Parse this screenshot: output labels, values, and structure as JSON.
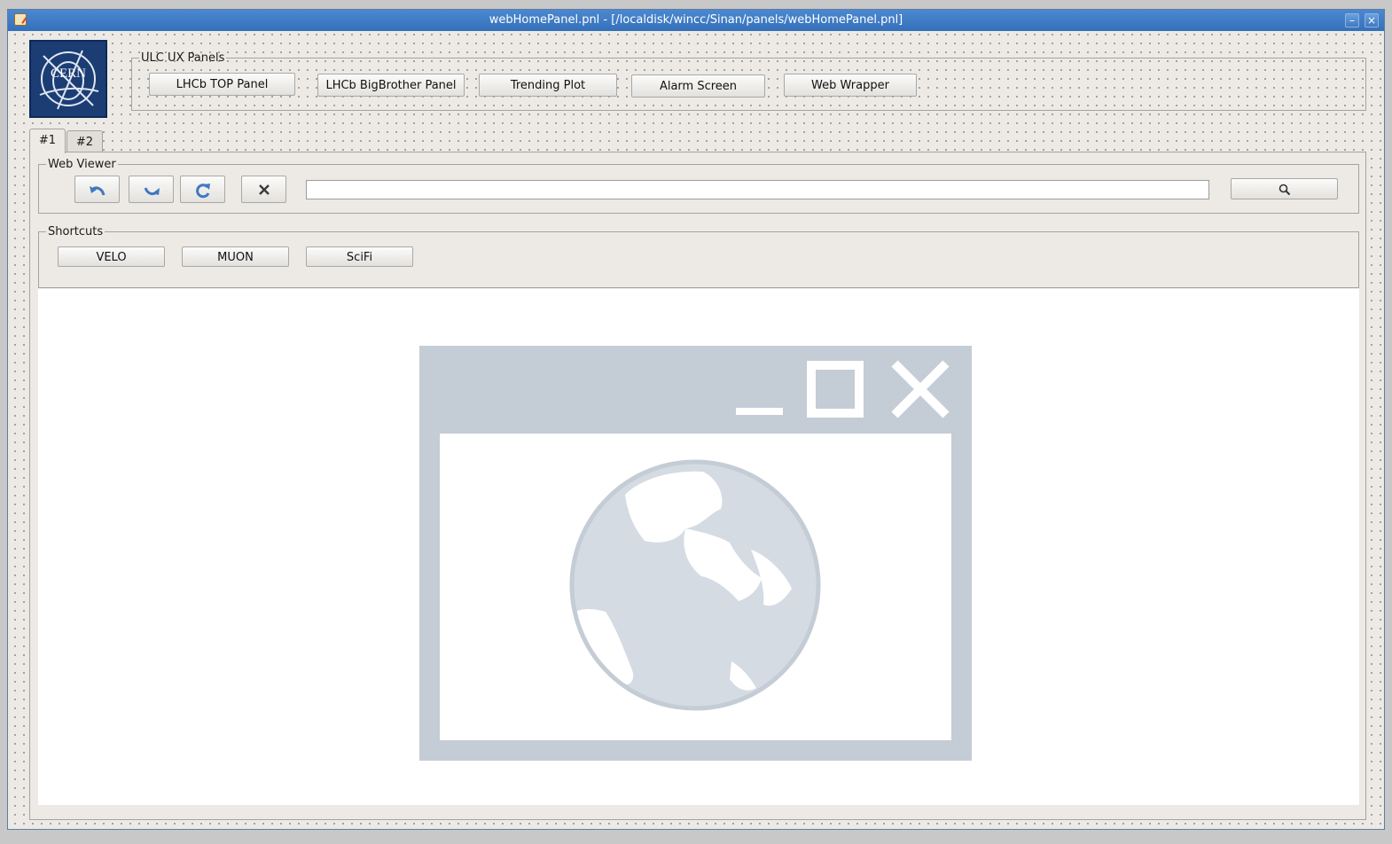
{
  "window": {
    "title": "webHomePanel.pnl - [/localdisk/wincc/Sinan/panels/webHomePanel.pnl]",
    "logo_text": "CERN"
  },
  "ux_panels": {
    "legend": "ULC UX Panels",
    "buttons": [
      "LHCb TOP Panel",
      "LHCb BigBrother Panel",
      "Trending Plot",
      "Alarm Screen",
      "Web Wrapper"
    ]
  },
  "tabs": [
    "#1",
    "#2"
  ],
  "web_viewer": {
    "legend": "Web Viewer",
    "url_value": "",
    "url_placeholder": ""
  },
  "shortcuts": {
    "legend": "Shortcuts",
    "buttons": [
      "VELO",
      "MUON",
      "SciFi"
    ]
  },
  "icons": {
    "back": "undo-arrow-icon",
    "forward": "redo-arrow-icon",
    "reload": "reload-icon",
    "stop": "close-icon",
    "search": "search-icon",
    "placeholder": "web-browser-globe-icon"
  },
  "colors": {
    "titlebar": "#3f7ec6",
    "panel_bg": "#edeae5",
    "logo_bg": "#1b3d74",
    "nav_icon": "#3f78c2",
    "placeholder_gray": "#c4ccd6"
  }
}
